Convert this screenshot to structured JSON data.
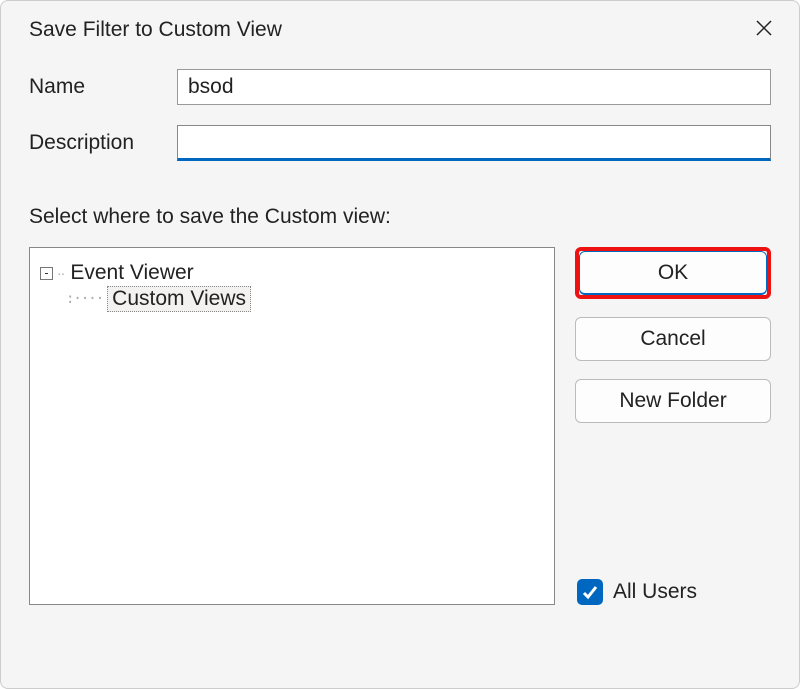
{
  "dialog": {
    "title": "Save Filter to Custom View",
    "labels": {
      "name": "Name",
      "description": "Description",
      "select_prompt": "Select where to save the Custom view:"
    },
    "fields": {
      "name_value": "bsod",
      "description_value": ""
    },
    "tree": {
      "root": "Event Viewer",
      "child": "Custom Views",
      "expander_glyph": "-"
    },
    "buttons": {
      "ok": "OK",
      "cancel": "Cancel",
      "new_folder": "New Folder"
    },
    "checkbox": {
      "all_users_label": "All Users",
      "all_users_checked": true
    }
  }
}
